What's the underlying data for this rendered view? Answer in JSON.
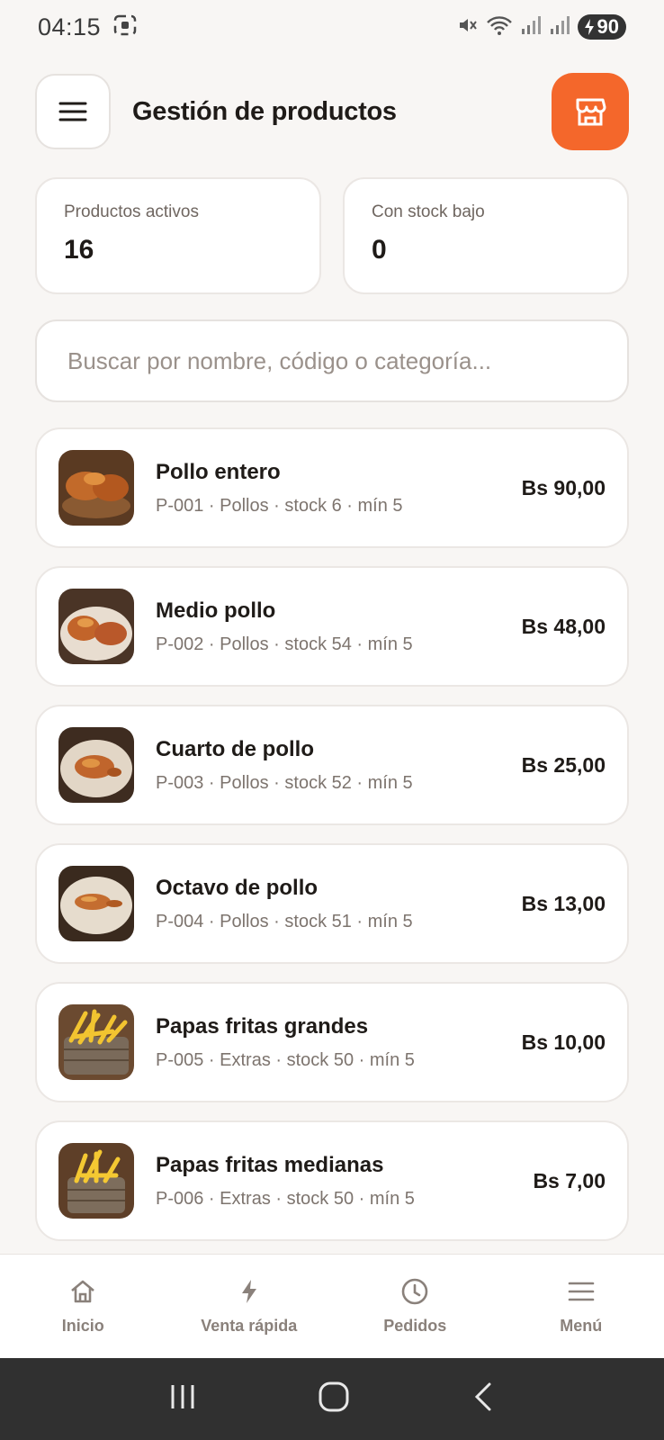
{
  "status_bar": {
    "time": "04:15",
    "battery": "90"
  },
  "header": {
    "title": "Gestión de productos"
  },
  "stats": [
    {
      "label": "Productos activos",
      "value": "16"
    },
    {
      "label": "Con stock bajo",
      "value": "0"
    }
  ],
  "search": {
    "placeholder": "Buscar por nombre, código o categoría..."
  },
  "products": [
    {
      "name": "Pollo entero",
      "meta": "P-001 · Pollos · stock 6 · mín 5",
      "price": "Bs 90,00",
      "image": "whole-chicken"
    },
    {
      "name": "Medio pollo",
      "meta": "P-002 · Pollos · stock 54 · mín 5",
      "price": "Bs 48,00",
      "image": "half-chicken"
    },
    {
      "name": "Cuarto de pollo",
      "meta": "P-003 · Pollos · stock 52 · mín 5",
      "price": "Bs 25,00",
      "image": "quarter-chicken"
    },
    {
      "name": "Octavo de pollo",
      "meta": "P-004 · Pollos · stock 51 · mín 5",
      "price": "Bs 13,00",
      "image": "eighth-chicken"
    },
    {
      "name": "Papas fritas grandes",
      "meta": "P-005 · Extras · stock 50 · mín 5",
      "price": "Bs 10,00",
      "image": "large-fries"
    },
    {
      "name": "Papas fritas medianas",
      "meta": "P-006 · Extras · stock 50 · mín 5",
      "price": "Bs 7,00",
      "image": "medium-fries"
    }
  ],
  "bottom_nav": [
    {
      "label": "Inicio",
      "icon": "home-icon"
    },
    {
      "label": "Venta rápida",
      "icon": "bolt-icon"
    },
    {
      "label": "Pedidos",
      "icon": "clock-icon"
    },
    {
      "label": "Menú",
      "icon": "menu-icon"
    }
  ],
  "colors": {
    "accent": "#f4672b",
    "background": "#f8f6f4",
    "card": "#ffffff",
    "muted_text": "#7d746e"
  }
}
